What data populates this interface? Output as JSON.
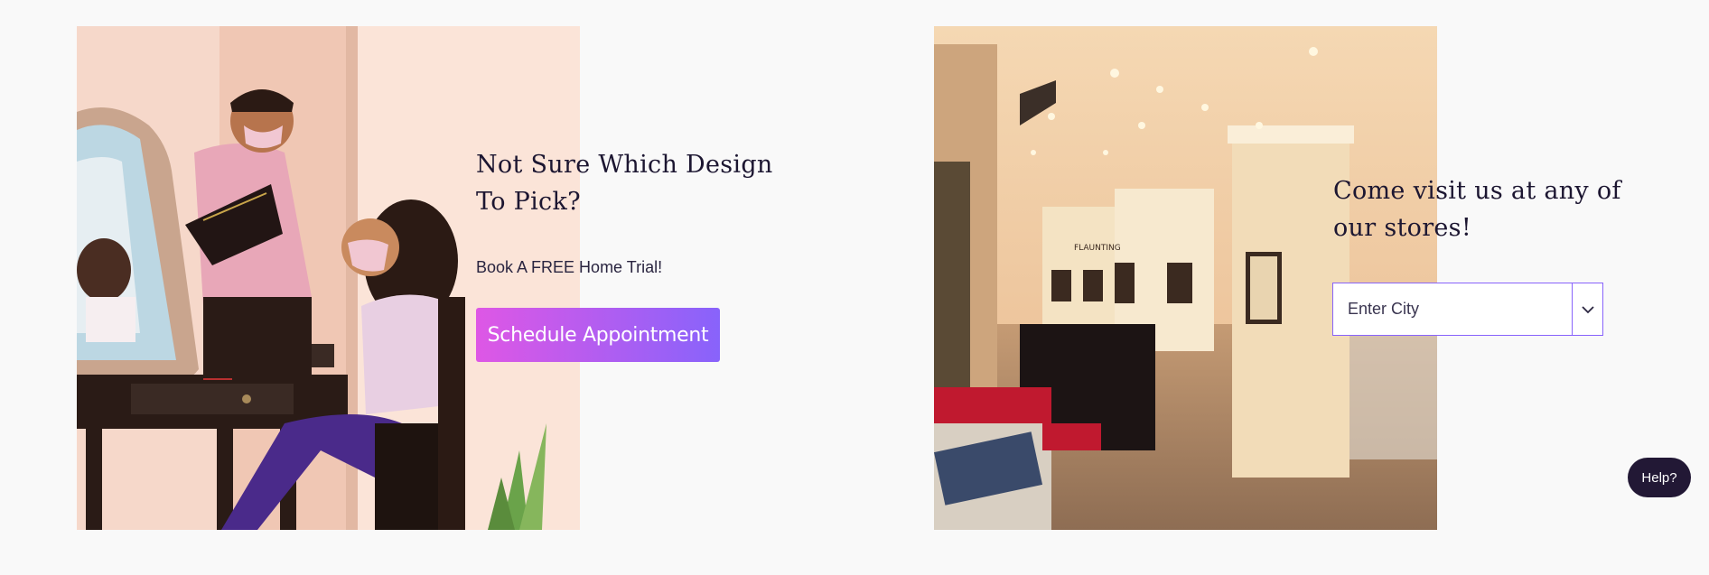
{
  "trial": {
    "heading": "Not Sure Which Design To Pick?",
    "subtext": "Book A FREE Home Trial!",
    "button_label": "Schedule Appointment"
  },
  "stores": {
    "heading": "Come visit us at any of our stores!",
    "city_placeholder": "Enter City",
    "store_sign": "FLAUNTING"
  },
  "help": {
    "label": "Help?"
  },
  "icons": {
    "dropdown": "chevron-down-icon"
  },
  "colors": {
    "text_dark": "#1c1631",
    "gradient_start": "#de57e5",
    "gradient_end": "#8863fb",
    "help_bg": "#221835"
  }
}
